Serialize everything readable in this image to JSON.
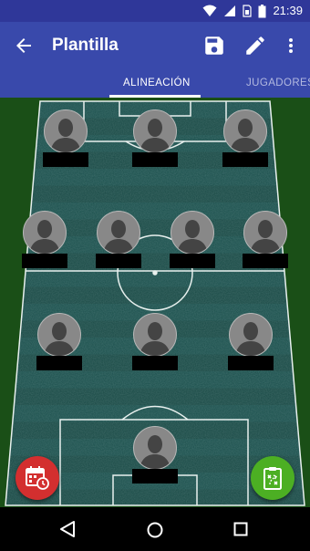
{
  "status_bar": {
    "time": "21:39",
    "icons": [
      "wifi-icon",
      "signal-icon",
      "sim-card-icon",
      "battery-icon"
    ],
    "background": "#2f3799"
  },
  "app_bar": {
    "title": "Plantilla",
    "background": "#3949ab",
    "actions": [
      "back-arrow-icon",
      "save-icon",
      "edit-pencil-icon",
      "more-vert-icon"
    ]
  },
  "tabs": [
    {
      "label": "ALINEACIÓN",
      "selected": true
    },
    {
      "label": "JUGADORES",
      "selected": false
    }
  ],
  "lineup": {
    "formation_rows": [
      3,
      4,
      3,
      1
    ],
    "players": [
      {
        "position": "forward-left"
      },
      {
        "position": "forward-center"
      },
      {
        "position": "forward-right"
      },
      {
        "position": "midfielder-1"
      },
      {
        "position": "midfielder-2"
      },
      {
        "position": "midfielder-3"
      },
      {
        "position": "midfielder-4"
      },
      {
        "position": "defender-left"
      },
      {
        "position": "defender-center"
      },
      {
        "position": "defender-right"
      },
      {
        "position": "goalkeeper"
      }
    ]
  },
  "fabs": {
    "calendar": {
      "icon": "calendar-clock-icon",
      "color": "#d32f2f"
    },
    "tactics": {
      "icon": "tactics-board-icon",
      "color": "#4caf23"
    }
  },
  "nav_bar": {
    "icons": [
      "nav-back-icon",
      "nav-home-icon",
      "nav-recent-icon"
    ]
  }
}
